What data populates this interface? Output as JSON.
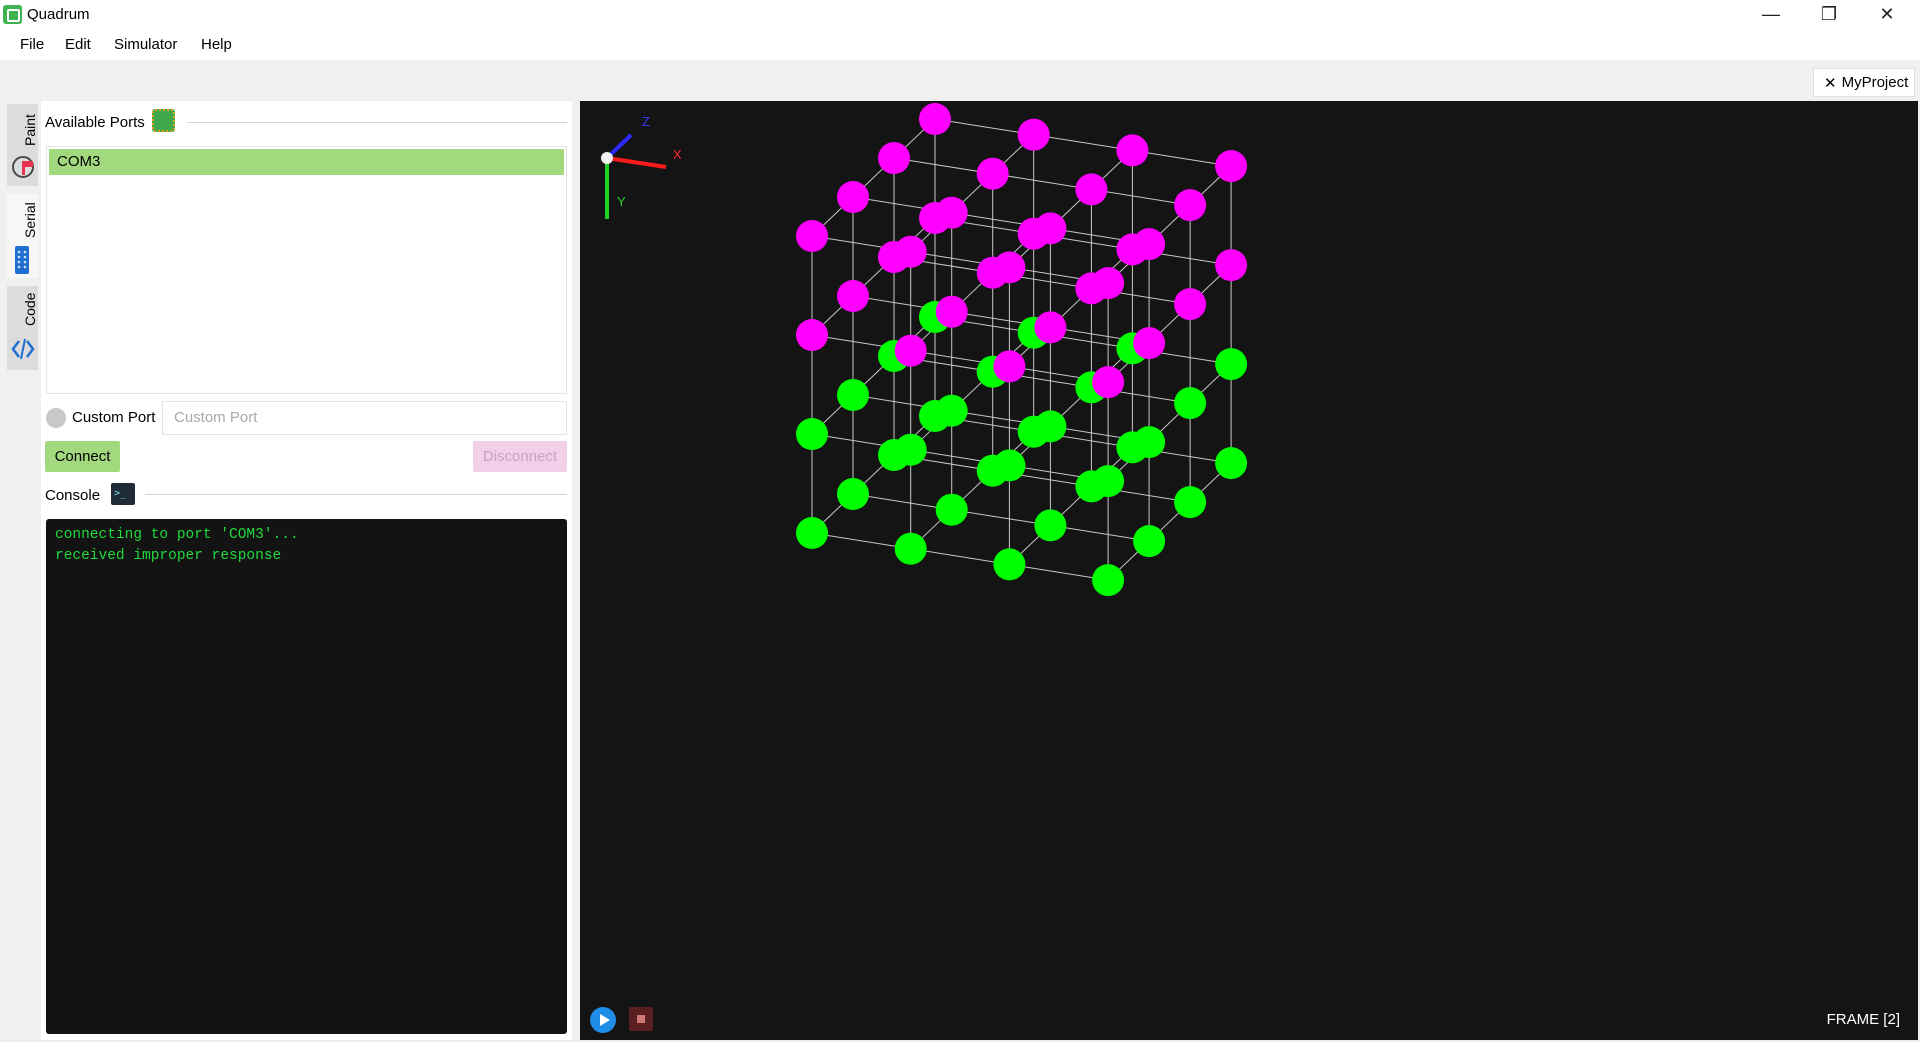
{
  "window": {
    "title": "Quadrum",
    "minimize_glyph": "—",
    "maximize_glyph": "❐",
    "close_glyph": "✕"
  },
  "menu": [
    "File",
    "Edit",
    "Simulator",
    "Help"
  ],
  "project_tab": {
    "close_glyph": "✕",
    "label": "MyProject"
  },
  "side_tabs": [
    {
      "label": "Paint",
      "icon": "paint-icon"
    },
    {
      "label": "Serial",
      "icon": "serial-icon"
    },
    {
      "label": "Code",
      "icon": "code-icon"
    }
  ],
  "serial": {
    "available_ports_title": "Available Ports",
    "ports": [
      "COM3"
    ],
    "selected_port": "COM3",
    "custom_port_label": "Custom Port",
    "custom_port_placeholder": "Custom Port",
    "connect_label": "Connect",
    "disconnect_label": "Disconnect",
    "console_title": "Console",
    "terminal_glyph": ">_",
    "console_lines": [
      "connecting to port 'COM3'...",
      "received improper response"
    ]
  },
  "viewport": {
    "axes": {
      "x": "X",
      "y": "Y",
      "z": "Z"
    },
    "frame_label": "FRAME [2]",
    "led_on_color": "#ff00ff",
    "led_off_color": "#00ff00",
    "grid_color": "#c8c8c8",
    "cube_size": 4
  },
  "colors": {
    "accent_green": "#a2d97f",
    "disconnect_pink": "#f1cfe9",
    "console_bg": "#131313",
    "console_text": "#21d93b"
  }
}
